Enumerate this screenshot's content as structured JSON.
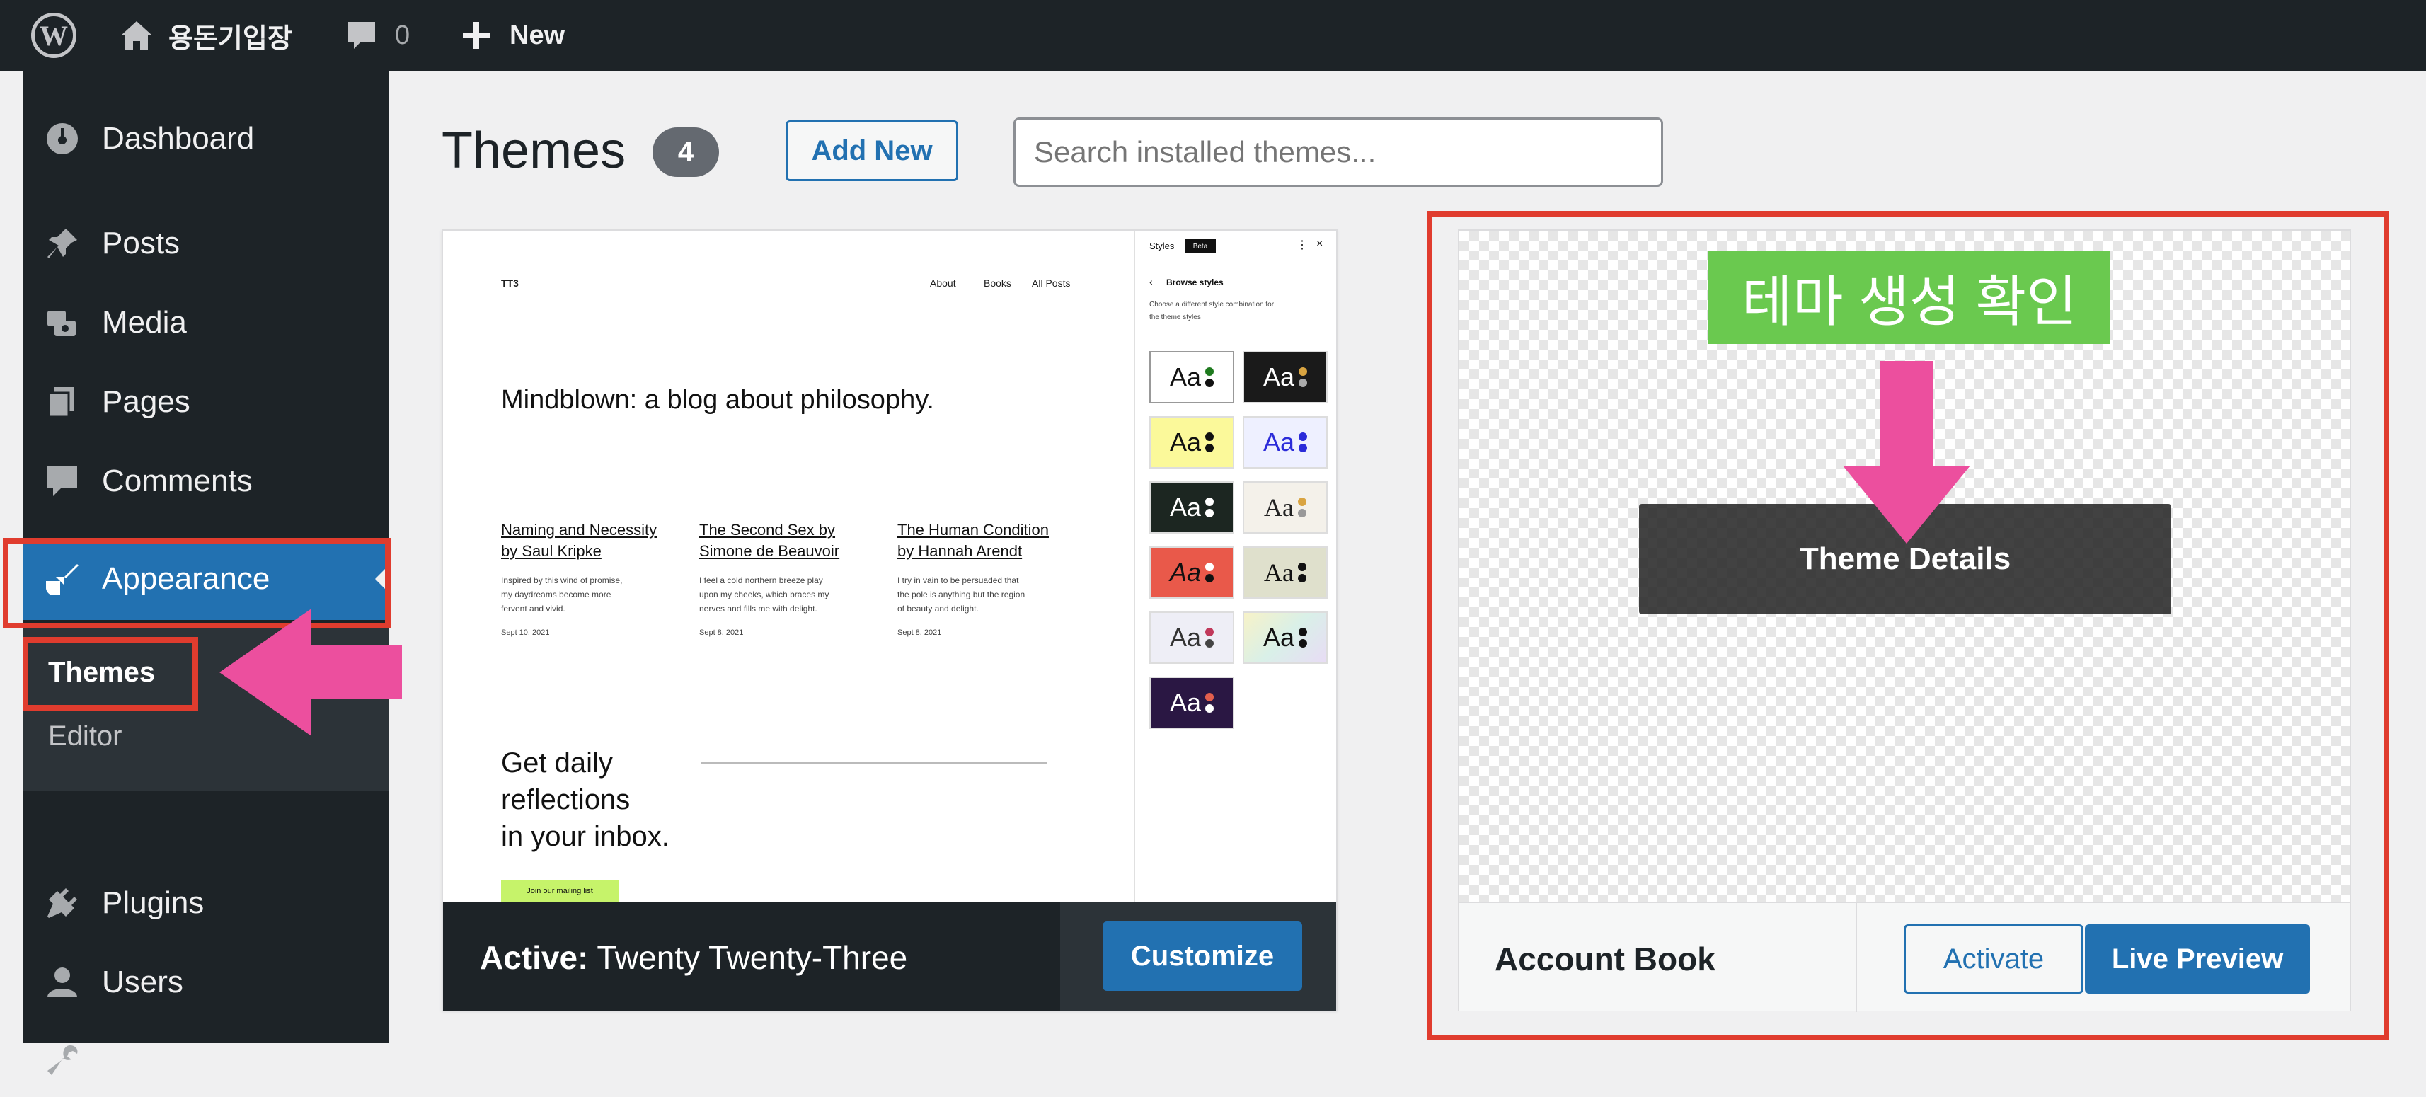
{
  "adminbar": {
    "wp_logo": "W",
    "site_name": "용돈기입장",
    "comments_count": "0",
    "new_label": "New"
  },
  "sidebar": {
    "items": [
      {
        "label": "Dashboard"
      },
      {
        "label": "Posts"
      },
      {
        "label": "Media"
      },
      {
        "label": "Pages"
      },
      {
        "label": "Comments"
      },
      {
        "label": "Appearance"
      },
      {
        "label": "Plugins"
      },
      {
        "label": "Users"
      },
      {
        "label": "Tools"
      }
    ],
    "submenu": [
      {
        "label": "Themes"
      },
      {
        "label": "Editor"
      }
    ]
  },
  "header": {
    "title": "Themes",
    "count": "4",
    "add_new": "Add New",
    "search_placeholder": "Search installed themes..."
  },
  "active_theme": {
    "preview": {
      "site_title": "TT3",
      "nav": [
        "About",
        "Books",
        "All Posts"
      ],
      "headline": "Mindblown: a blog about philosophy.",
      "posts": [
        {
          "title1": "Naming and Necessity",
          "title2": "by Saul Kripke",
          "excerpt": [
            "Inspired by this wind of promise,",
            "my daydreams become more",
            "fervent and vivid."
          ],
          "date": "Sept 10, 2021"
        },
        {
          "title1": "The Second Sex by",
          "title2": "Simone de Beauvoir",
          "excerpt": [
            "I feel a cold northern breeze play",
            "upon my cheeks, which braces my",
            "nerves and fills me with delight."
          ],
          "date": "Sept 8, 2021"
        },
        {
          "title1": "The Human Condition",
          "title2": "by Hannah Arendt",
          "excerpt": [
            "I try in vain to be persuaded that",
            "the pole is anything but the region",
            "of beauty and delight."
          ],
          "date": "Sept 8, 2021"
        }
      ],
      "subscribe": [
        "Get daily",
        "reflections",
        "in your inbox."
      ],
      "join_button": "Join our mailing list",
      "styles_panel": {
        "title": "Styles",
        "badge": "Beta",
        "back_label": "Browse styles",
        "description": [
          "Choose a different style combination for",
          "the theme styles"
        ],
        "swatch_text": "Aa"
      }
    },
    "label_bold": "Active:",
    "name": "Twenty Twenty-Three",
    "customize": "Customize"
  },
  "second_theme": {
    "annotation": "테마 생성 확인",
    "details_button": "Theme Details",
    "name": "Account Book",
    "activate": "Activate",
    "live_preview": "Live Preview"
  },
  "colors": {
    "adminbar_bg": "#1d2327",
    "accent": "#2271b1",
    "annotation_green": "#6ac94f",
    "arrow_pink": "#ec4f9e",
    "highlight_red": "#e03c2e"
  }
}
